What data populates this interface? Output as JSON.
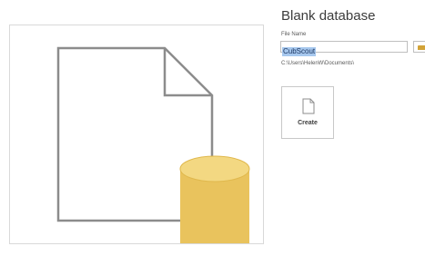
{
  "dialog": {
    "title": "Blank database",
    "file_name_label": "File Name",
    "file_name_value": "CubScout",
    "path": "C:\\Users\\HelenW\\Documents\\"
  },
  "actions": {
    "create_label": "Create"
  },
  "icons": {
    "preview": "blank-document-database-icon",
    "browse": "folder-icon",
    "create": "document-icon"
  },
  "colors": {
    "database_fill": "#e9c35d",
    "database_top": "#f3d882",
    "document_stroke": "#8c8c8c",
    "selection": "#a7c8ee",
    "folder": "#d2a338"
  }
}
